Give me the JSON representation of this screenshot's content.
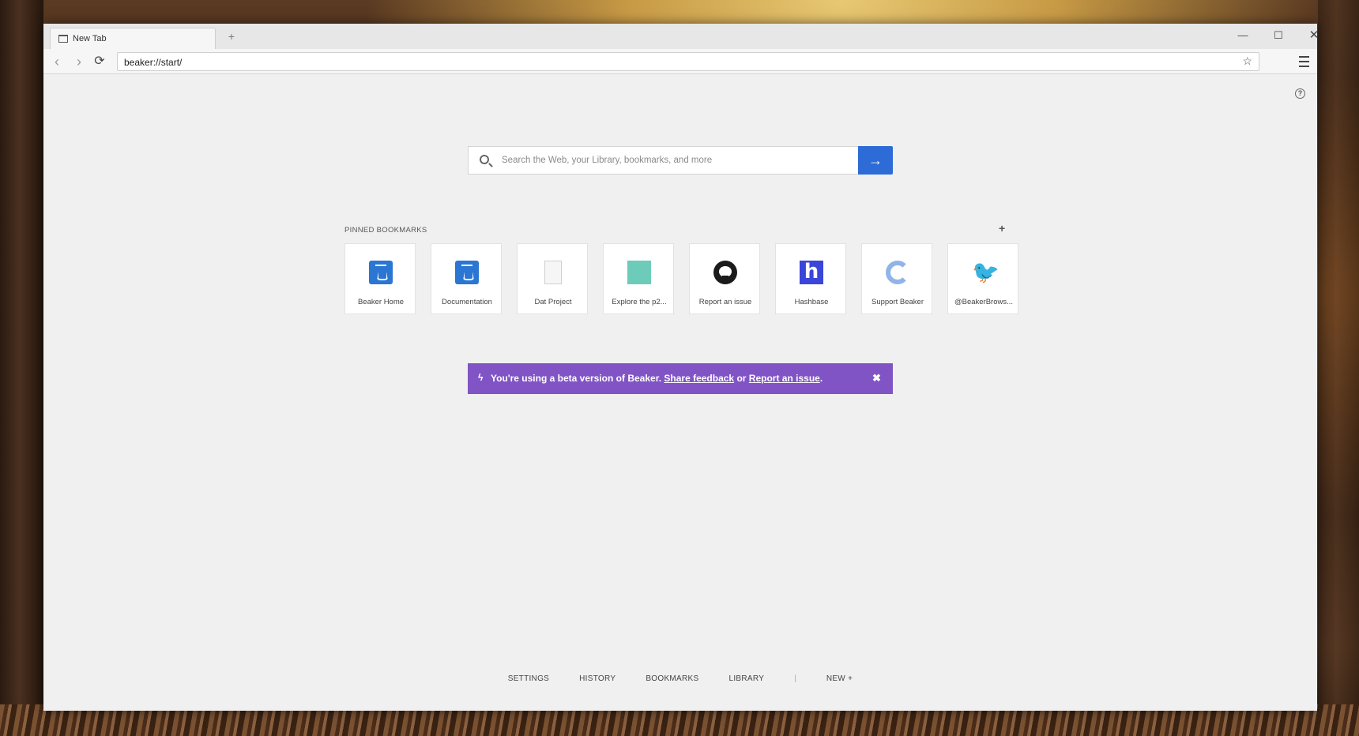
{
  "browser": {
    "tab_label": "New Tab",
    "new_tab": "+",
    "url": "beaker://start/",
    "minimize": "—",
    "maximize": "☐",
    "close": "✕"
  },
  "search": {
    "placeholder": "Search the Web, your Library, bookmarks, and more",
    "go": "→"
  },
  "pinned": {
    "title": "PINNED BOOKMARKS",
    "add": "+",
    "items": [
      {
        "label": "Beaker Home",
        "icon": "beaker-icon"
      },
      {
        "label": "Documentation",
        "icon": "beaker-icon"
      },
      {
        "label": "Dat Project",
        "icon": "page-icon"
      },
      {
        "label": "Explore the p2...",
        "icon": "teal-square-icon"
      },
      {
        "label": "Report an issue",
        "icon": "github-icon"
      },
      {
        "label": "Hashbase",
        "icon": "hashbase-icon",
        "glyph": "h"
      },
      {
        "label": "Support Beaker",
        "icon": "support-icon"
      },
      {
        "label": "@BeakerBrows...",
        "icon": "twitter-icon",
        "glyph": "🐦"
      }
    ]
  },
  "beta": {
    "text": "You're using a beta version of Beaker.",
    "link1": "Share feedback",
    "or": "or",
    "link2": "Report an issue",
    "period": ".",
    "close": "✖"
  },
  "footer": {
    "links": [
      "SETTINGS",
      "HISTORY",
      "BOOKMARKS",
      "LIBRARY"
    ],
    "separator": "|",
    "new": "NEW +"
  },
  "colors": {
    "accent_blue": "#2d6bd6",
    "beta_purple": "#8154c6"
  }
}
